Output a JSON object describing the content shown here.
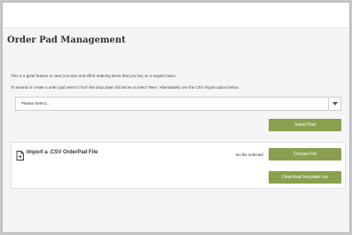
{
  "page": {
    "title": "Order Pad Management",
    "intro_line1": "This is a great feature to save you time and effort ordering items that you buy on a regular basis.",
    "intro_line2": "To amend or create a order pad select it from the drop down list below or select 'New'. Alternatively use the CSV import option below."
  },
  "pad_select": {
    "selected": "Please Select..."
  },
  "buttons": {
    "select_pad": "Select Pad",
    "choose_file": "Choose File",
    "download_template": "Download template csv"
  },
  "import": {
    "title": "Import a .CSV OrderPad File",
    "file_status": "No file selected"
  },
  "colors": {
    "accent": "#8aa04f"
  },
  "icons": {
    "file": "file-import-icon",
    "dropdown": "chevron-down-icon"
  }
}
